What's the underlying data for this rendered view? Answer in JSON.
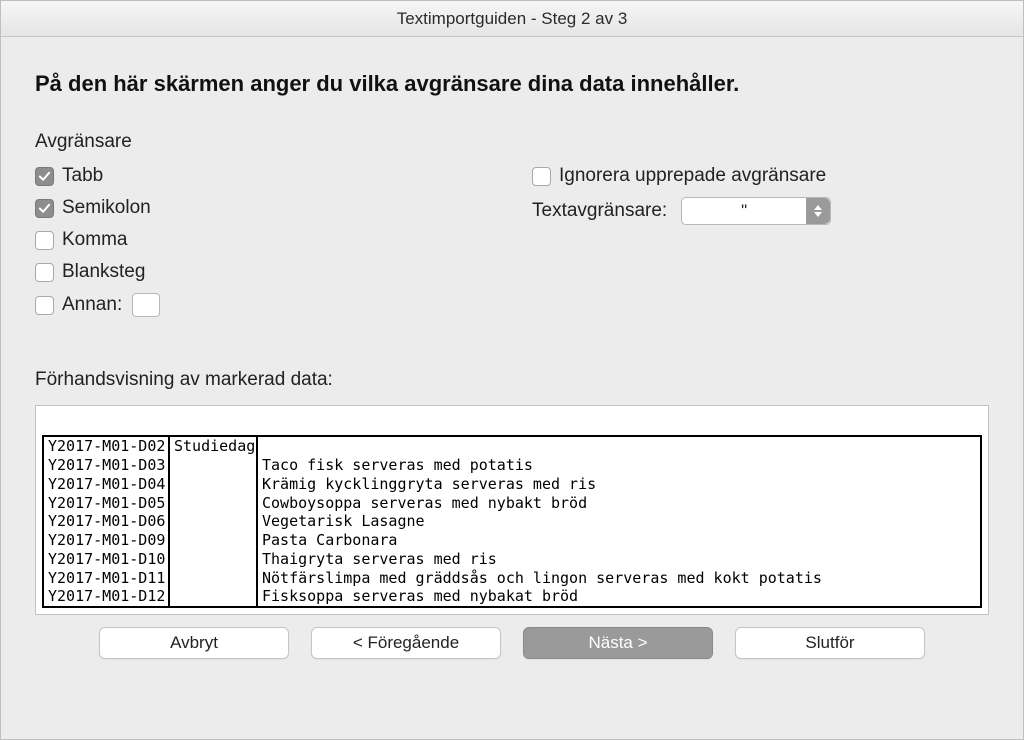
{
  "window_title": "Textimportguiden - Steg 2 av 3",
  "heading": "På den här skärmen anger du vilka avgränsare dina data innehåller.",
  "delimiters": {
    "section_label": "Avgränsare",
    "tab": "Tabb",
    "semicolon": "Semikolon",
    "comma": "Komma",
    "space": "Blanksteg",
    "other": "Annan:",
    "other_value": ""
  },
  "ignore_repeated": "Ignorera upprepade avgränsare",
  "text_qualifier_label": "Textavgränsare:",
  "text_qualifier_value": "\"",
  "preview_label": "Förhandsvisning av markerad data:",
  "preview_rows": [
    {
      "c0": "Y2017-M01-D02",
      "c1": "Studiedag",
      "c2": ""
    },
    {
      "c0": "Y2017-M01-D03",
      "c1": "",
      "c2": "Taco fisk serveras med potatis"
    },
    {
      "c0": "Y2017-M01-D04",
      "c1": "",
      "c2": "Krämig kycklinggryta serveras med ris"
    },
    {
      "c0": "Y2017-M01-D05",
      "c1": "",
      "c2": "Cowboysoppa serveras med nybakt bröd"
    },
    {
      "c0": "Y2017-M01-D06",
      "c1": "",
      "c2": "Vegetarisk Lasagne"
    },
    {
      "c0": "Y2017-M01-D09",
      "c1": "",
      "c2": "Pasta Carbonara"
    },
    {
      "c0": "Y2017-M01-D10",
      "c1": "",
      "c2": "Thaigryta serveras med ris"
    },
    {
      "c0": "Y2017-M01-D11",
      "c1": "",
      "c2": "Nötfärslimpa med gräddsås och lingon serveras med kokt potatis"
    },
    {
      "c0": "Y2017-M01-D12",
      "c1": "",
      "c2": "Fisksoppa serveras med nybakat bröd"
    }
  ],
  "buttons": {
    "cancel": "Avbryt",
    "back": "< Föregående",
    "next": "Nästa >",
    "finish": "Slutför"
  }
}
